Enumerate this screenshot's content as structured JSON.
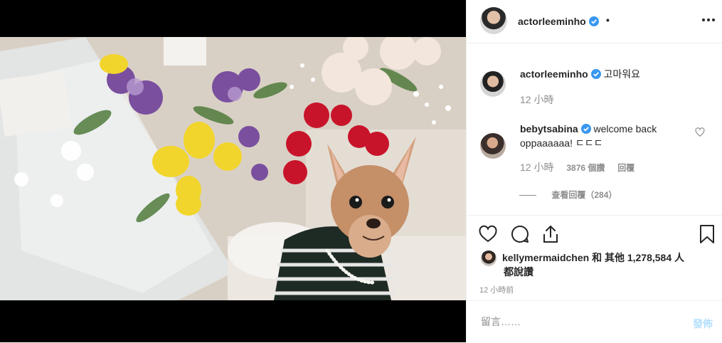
{
  "post": {
    "image_description_alt": "",
    "author": "actorleeminho",
    "separator": "•"
  },
  "comments": [
    {
      "username": "actorleeminho",
      "text": "고마워요",
      "time": "12 小時"
    },
    {
      "username": "bebytsabina",
      "text": "welcome back oppaaaaaa! ㄷㄷㄷ",
      "time": "12 小時",
      "likes": "3876 個讚",
      "reply": "回覆"
    }
  ],
  "view_replies": "查看回覆（284）",
  "likes_summary": {
    "user": "kellymermaidchen",
    "text": "和 其他 1,278,584 人",
    "text2": "都說讚"
  },
  "timestamp": "12 小時前",
  "comment_box": {
    "placeholder": "留言……",
    "post_label": "發佈"
  },
  "colors": {
    "verified": "#3897f0",
    "muted": "#8e8e8e",
    "post_disabled": "#b2dffc"
  },
  "icons": [
    "more-options-icon",
    "verified-badge-icon",
    "heart-icon",
    "comment-icon",
    "share-icon",
    "bookmark-icon"
  ]
}
